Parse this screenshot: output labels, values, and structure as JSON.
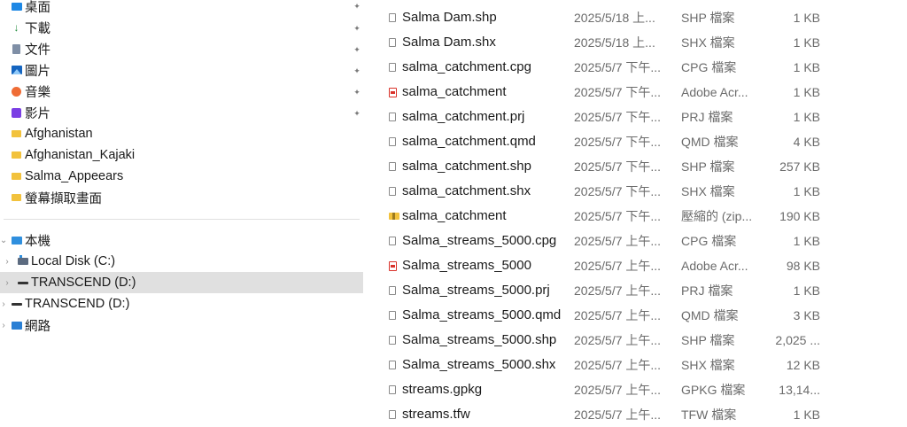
{
  "nav": {
    "quick_access": [
      {
        "label": "桌面",
        "icon": "desktop-icon"
      },
      {
        "label": "下載",
        "icon": "download-icon"
      },
      {
        "label": "文件",
        "icon": "documents-icon"
      },
      {
        "label": "圖片",
        "icon": "pictures-icon"
      },
      {
        "label": "音樂",
        "icon": "music-icon"
      },
      {
        "label": "影片",
        "icon": "videos-icon"
      }
    ],
    "folders": [
      {
        "label": "Afghanistan"
      },
      {
        "label": "Afghanistan_Kajaki"
      },
      {
        "label": "Salma_Appeears"
      },
      {
        "label": "螢幕擷取畫面"
      }
    ],
    "this_pc": "本機",
    "local_disk": "Local Disk (C:)",
    "transcend_selected": "TRANSCEND (D:)",
    "transcend": "TRANSCEND (D:)",
    "network": "網路"
  },
  "files": [
    {
      "name": "Salma Dam.shp",
      "date": "2025/5/18 上...",
      "type": "SHP 檔案",
      "size": "1 KB",
      "icon": "generic"
    },
    {
      "name": "Salma Dam.shx",
      "date": "2025/5/18 上...",
      "type": "SHX 檔案",
      "size": "1 KB",
      "icon": "generic"
    },
    {
      "name": "salma_catchment.cpg",
      "date": "2025/5/7 下午...",
      "type": "CPG 檔案",
      "size": "1 KB",
      "icon": "generic"
    },
    {
      "name": "salma_catchment",
      "date": "2025/5/7 下午...",
      "type": "Adobe Acr...",
      "size": "1 KB",
      "icon": "pdf"
    },
    {
      "name": "salma_catchment.prj",
      "date": "2025/5/7 下午...",
      "type": "PRJ 檔案",
      "size": "1 KB",
      "icon": "generic"
    },
    {
      "name": "salma_catchment.qmd",
      "date": "2025/5/7 下午...",
      "type": "QMD 檔案",
      "size": "4 KB",
      "icon": "generic"
    },
    {
      "name": "salma_catchment.shp",
      "date": "2025/5/7 下午...",
      "type": "SHP 檔案",
      "size": "257 KB",
      "icon": "generic"
    },
    {
      "name": "salma_catchment.shx",
      "date": "2025/5/7 下午...",
      "type": "SHX 檔案",
      "size": "1 KB",
      "icon": "generic"
    },
    {
      "name": "salma_catchment",
      "date": "2025/5/7 下午...",
      "type": "壓縮的 (zip...",
      "size": "190 KB",
      "icon": "zip"
    },
    {
      "name": "Salma_streams_5000.cpg",
      "date": "2025/5/7 上午...",
      "type": "CPG 檔案",
      "size": "1 KB",
      "icon": "generic"
    },
    {
      "name": "Salma_streams_5000",
      "date": "2025/5/7 上午...",
      "type": "Adobe Acr...",
      "size": "98 KB",
      "icon": "pdf"
    },
    {
      "name": "Salma_streams_5000.prj",
      "date": "2025/5/7 上午...",
      "type": "PRJ 檔案",
      "size": "1 KB",
      "icon": "generic"
    },
    {
      "name": "Salma_streams_5000.qmd",
      "date": "2025/5/7 上午...",
      "type": "QMD 檔案",
      "size": "3 KB",
      "icon": "generic"
    },
    {
      "name": "Salma_streams_5000.shp",
      "date": "2025/5/7 上午...",
      "type": "SHP 檔案",
      "size": "2,025 ...",
      "icon": "generic"
    },
    {
      "name": "Salma_streams_5000.shx",
      "date": "2025/5/7 上午...",
      "type": "SHX 檔案",
      "size": "12 KB",
      "icon": "generic"
    },
    {
      "name": "streams.gpkg",
      "date": "2025/5/7 上午...",
      "type": "GPKG 檔案",
      "size": "13,14...",
      "icon": "generic"
    },
    {
      "name": "streams.tfw",
      "date": "2025/5/7 上午...",
      "type": "TFW 檔案",
      "size": "1 KB",
      "icon": "generic"
    }
  ]
}
